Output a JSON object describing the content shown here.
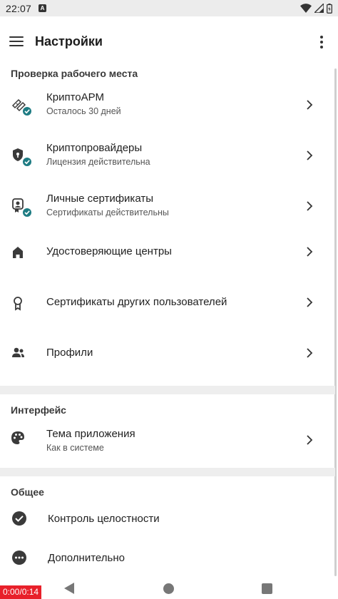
{
  "status_bar": {
    "time": "22:07",
    "notification_badge": "A"
  },
  "app_bar": {
    "title": "Настройки"
  },
  "sections": {
    "workplace": {
      "title": "Проверка рабочего места",
      "items": [
        {
          "label": "КриптоАРМ",
          "sub": "Осталось 30 дней",
          "icon": "crypto-arm-icon"
        },
        {
          "label": "Криптопровайдеры",
          "sub": "Лицензия действительна",
          "icon": "shield-icon"
        },
        {
          "label": "Личные сертификаты",
          "sub": "Сертификаты действительны",
          "icon": "personal-certificate-icon"
        },
        {
          "label": "Удостоверяющие центры",
          "icon": "home-icon"
        },
        {
          "label": "Сертификаты других пользователей",
          "icon": "ribbon-award-icon"
        },
        {
          "label": "Профили",
          "icon": "people-icon"
        }
      ]
    },
    "interface": {
      "title": "Интерфейс",
      "items": [
        {
          "label": "Тема приложения",
          "sub": "Как в системе",
          "icon": "palette-icon"
        }
      ]
    },
    "general": {
      "title": "Общее",
      "items": [
        {
          "label": "Контроль целостности",
          "icon": "check-circle-icon"
        },
        {
          "label": "Дополнительно",
          "icon": "more-circle-icon"
        }
      ]
    }
  },
  "recording_timer": "0:00/0:14",
  "colors": {
    "accent": "#1e7c83",
    "icon": "#3a3a3a",
    "divider": "#eeeeee",
    "timer": "#e8202a"
  }
}
